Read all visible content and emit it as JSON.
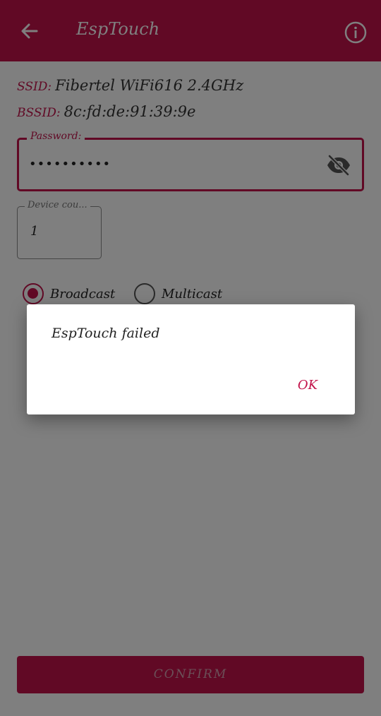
{
  "app_bar": {
    "title": "EspTouch",
    "back_icon": "arrow-left-icon",
    "info_icon": "info-circle-icon",
    "color": "#c2124a"
  },
  "wifi_info": {
    "ssid_label": "SSID:",
    "ssid_value": "Fibertel WiFi616 2.4GHz",
    "bssid_label": "BSSID:",
    "bssid_value": "8c:fd:de:91:39:9e"
  },
  "password": {
    "label": "Password:",
    "value": "••••••••••",
    "visibility_icon": "eye-off-icon"
  },
  "device_count": {
    "label": "Device cou...",
    "value": "1"
  },
  "mode": {
    "options": [
      {
        "label": "Broadcast",
        "selected": true
      },
      {
        "label": "Multicast",
        "selected": false
      }
    ]
  },
  "confirm_button": {
    "label": "CONFIRM"
  },
  "dialog": {
    "message": "EspTouch failed",
    "ok_label": "OK"
  },
  "colors": {
    "accent": "#c2124a",
    "scrim": "rgba(0,0,0,0.5)"
  }
}
